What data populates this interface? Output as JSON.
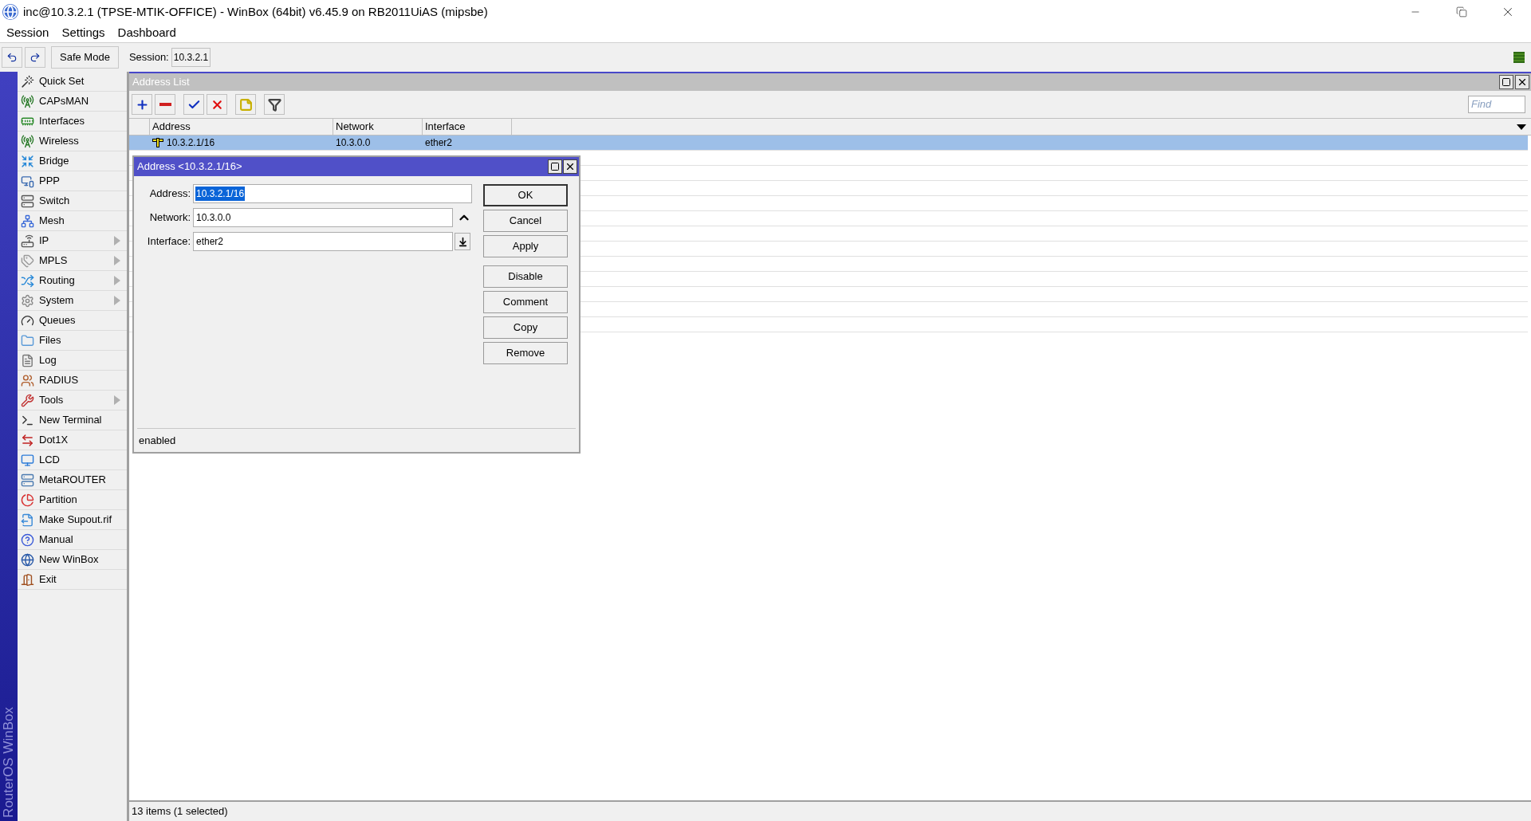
{
  "window": {
    "title": "inc@10.3.2.1 (TPSE-MTIK-OFFICE) - WinBox (64bit) v6.45.9 on RB2011UiAS (mipsbe)"
  },
  "menu": [
    "Session",
    "Settings",
    "Dashboard"
  ],
  "toolbar": {
    "safe_mode": "Safe Mode",
    "session_label": "Session:",
    "session_value": "10.3.2.1"
  },
  "sidebar": {
    "brand": "RouterOS WinBox",
    "items": [
      {
        "label": "Quick Set",
        "submenu": false
      },
      {
        "label": "CAPsMAN",
        "submenu": false
      },
      {
        "label": "Interfaces",
        "submenu": false
      },
      {
        "label": "Wireless",
        "submenu": false
      },
      {
        "label": "Bridge",
        "submenu": false
      },
      {
        "label": "PPP",
        "submenu": false
      },
      {
        "label": "Switch",
        "submenu": false
      },
      {
        "label": "Mesh",
        "submenu": false
      },
      {
        "label": "IP",
        "submenu": true
      },
      {
        "label": "MPLS",
        "submenu": true
      },
      {
        "label": "Routing",
        "submenu": true
      },
      {
        "label": "System",
        "submenu": true
      },
      {
        "label": "Queues",
        "submenu": false
      },
      {
        "label": "Files",
        "submenu": false
      },
      {
        "label": "Log",
        "submenu": false
      },
      {
        "label": "RADIUS",
        "submenu": false
      },
      {
        "label": "Tools",
        "submenu": true
      },
      {
        "label": "New Terminal",
        "submenu": false
      },
      {
        "label": "Dot1X",
        "submenu": false
      },
      {
        "label": "LCD",
        "submenu": false
      },
      {
        "label": "MetaROUTER",
        "submenu": false
      },
      {
        "label": "Partition",
        "submenu": false
      },
      {
        "label": "Make Supout.rif",
        "submenu": false
      },
      {
        "label": "Manual",
        "submenu": false
      },
      {
        "label": "New WinBox",
        "submenu": false
      },
      {
        "label": "Exit",
        "submenu": false
      }
    ]
  },
  "address_list": {
    "title": "Address List",
    "find_placeholder": "Find",
    "columns": [
      "Address",
      "Network",
      "Interface"
    ],
    "rows": [
      {
        "address": "10.3.2.1/16",
        "network": "10.3.0.0",
        "interface": "ether2",
        "selected": true
      }
    ],
    "status": "13 items (1 selected)"
  },
  "dialog": {
    "title": "Address <10.3.2.1/16>",
    "fields": [
      {
        "label": "Address:",
        "value": "10.3.2.1/16",
        "kind": "text",
        "selected": true
      },
      {
        "label": "Network:",
        "value": "10.3.0.0",
        "kind": "collapse",
        "selected": false
      },
      {
        "label": "Interface:",
        "value": "ether2",
        "kind": "dropdown",
        "selected": false
      }
    ],
    "buttons": [
      "OK",
      "Cancel",
      "Apply",
      "Disable",
      "Comment",
      "Copy",
      "Remove"
    ],
    "status": "enabled"
  }
}
